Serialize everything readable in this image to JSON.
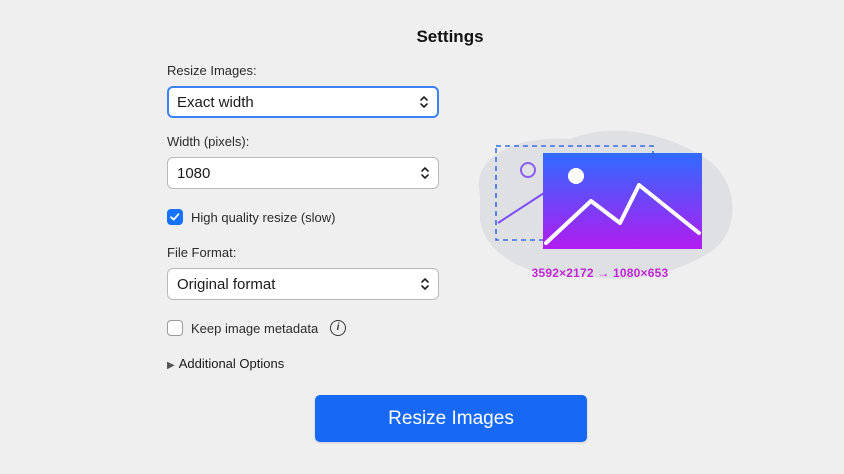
{
  "page": {
    "title": "Settings"
  },
  "resize": {
    "label": "Resize Images:",
    "value": "Exact width"
  },
  "width": {
    "label": "Width (pixels):",
    "value": "1080"
  },
  "high_quality": {
    "label": "High quality resize (slow)",
    "checked": true
  },
  "format": {
    "label": "File Format:",
    "value": "Original format"
  },
  "metadata": {
    "label": "Keep image metadata",
    "checked": false
  },
  "additional": {
    "label": "Additional Options"
  },
  "action": {
    "label": "Resize Images"
  },
  "preview": {
    "dimensions": "3592×2172 → 1080×653"
  },
  "colors": {
    "accent": "#1769f5",
    "gradient_top": "#2f6bff",
    "gradient_bottom": "#b21cf0",
    "dimension_text": "#c026d3"
  },
  "icons": {
    "select": "chevron-up-down-icon",
    "checkbox": "checkmark-icon",
    "info": "info-icon",
    "disclosure": "disclosure-triangle-icon",
    "preview": "image-icon"
  }
}
